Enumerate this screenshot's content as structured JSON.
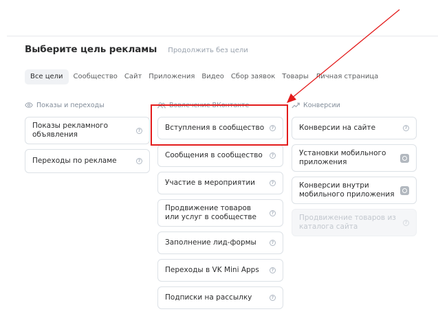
{
  "heading": {
    "title": "Выберите цель рекламы",
    "skip_link": "Продолжить без цели"
  },
  "tabs": [
    {
      "label": "Все цели",
      "active": true
    },
    {
      "label": "Сообщество"
    },
    {
      "label": "Сайт"
    },
    {
      "label": "Приложения"
    },
    {
      "label": "Видео"
    },
    {
      "label": "Сбор заявок"
    },
    {
      "label": "Товары"
    },
    {
      "label": "Личная страница"
    }
  ],
  "columns": {
    "impressions": {
      "title": "Показы и переходы",
      "icon": "eye-icon",
      "items": [
        "Показы рекламного объявления",
        "Переходы по рекламе"
      ]
    },
    "engagement": {
      "title": "Вовлечение ВКонтакте",
      "icon": "people-icon",
      "items": [
        "Вступления в сообщество",
        "Сообщения в сообщество",
        "Участие в мероприятии",
        "Продвижение товаров или услуг в сообществе",
        "Заполнение лид-формы",
        "Переходы в VK Mini Apps",
        "Подписки на рассылку"
      ]
    },
    "conversions": {
      "title": "Конверсии",
      "icon": "trend-icon",
      "items": [
        "Конверсии на сайте",
        "Установки мобильного приложения",
        "Конверсии внутри мобильного приложения",
        "Продвижение товаров из каталога сайта"
      ]
    }
  },
  "colors": {
    "annotation": "#e31b1b",
    "text": "#2c2d2e",
    "muted": "#818c99",
    "border": "#dce1e6"
  }
}
